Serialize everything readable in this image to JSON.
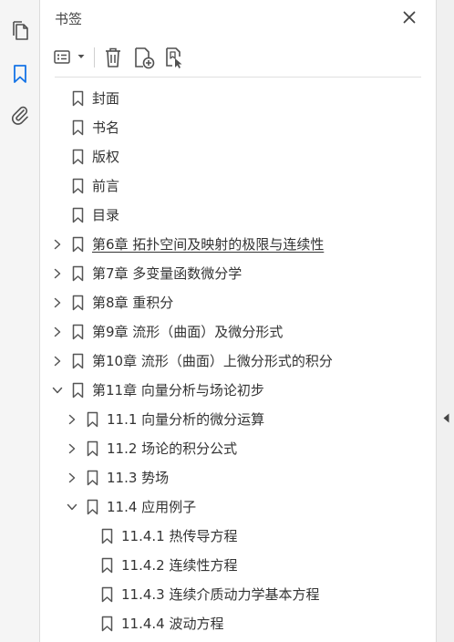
{
  "panel": {
    "title": "书签"
  },
  "rail": {
    "items": [
      {
        "name": "pages-icon",
        "active": false
      },
      {
        "name": "bookmark-icon",
        "active": true
      },
      {
        "name": "attachment-icon",
        "active": false
      }
    ]
  },
  "colors": {
    "accent": "#1473e6",
    "icon": "#505050",
    "text": "#333333"
  },
  "bookmarks": [
    {
      "label": "封面",
      "level": 0,
      "toggle": "none"
    },
    {
      "label": "书名",
      "level": 0,
      "toggle": "none"
    },
    {
      "label": "版权",
      "level": 0,
      "toggle": "none"
    },
    {
      "label": "前言",
      "level": 0,
      "toggle": "none"
    },
    {
      "label": "目录",
      "level": 0,
      "toggle": "none"
    },
    {
      "label": "第6章  拓扑空间及映射的极限与连续性",
      "level": 0,
      "toggle": "collapsed",
      "hovered": true
    },
    {
      "label": "第7章  多变量函数微分学",
      "level": 0,
      "toggle": "collapsed"
    },
    {
      "label": "第8章  重积分",
      "level": 0,
      "toggle": "collapsed"
    },
    {
      "label": "第9章  流形（曲面）及微分形式",
      "level": 0,
      "toggle": "collapsed"
    },
    {
      "label": "第10章  流形（曲面）上微分形式的积分",
      "level": 0,
      "toggle": "collapsed"
    },
    {
      "label": "第11章  向量分析与场论初步",
      "level": 0,
      "toggle": "expanded"
    },
    {
      "label": "11.1  向量分析的微分运算",
      "level": 1,
      "toggle": "collapsed"
    },
    {
      "label": "11.2  场论的积分公式",
      "level": 1,
      "toggle": "collapsed"
    },
    {
      "label": "11.3  势场",
      "level": 1,
      "toggle": "collapsed"
    },
    {
      "label": "11.4  应用例子",
      "level": 1,
      "toggle": "expanded"
    },
    {
      "label": "11.4.1  热传导方程",
      "level": 2,
      "toggle": "none"
    },
    {
      "label": "11.4.2  连续性方程",
      "level": 2,
      "toggle": "none"
    },
    {
      "label": "11.4.3  连续介质动力学基本方程",
      "level": 2,
      "toggle": "none"
    },
    {
      "label": "11.4.4  波动方程",
      "level": 2,
      "toggle": "none"
    }
  ]
}
